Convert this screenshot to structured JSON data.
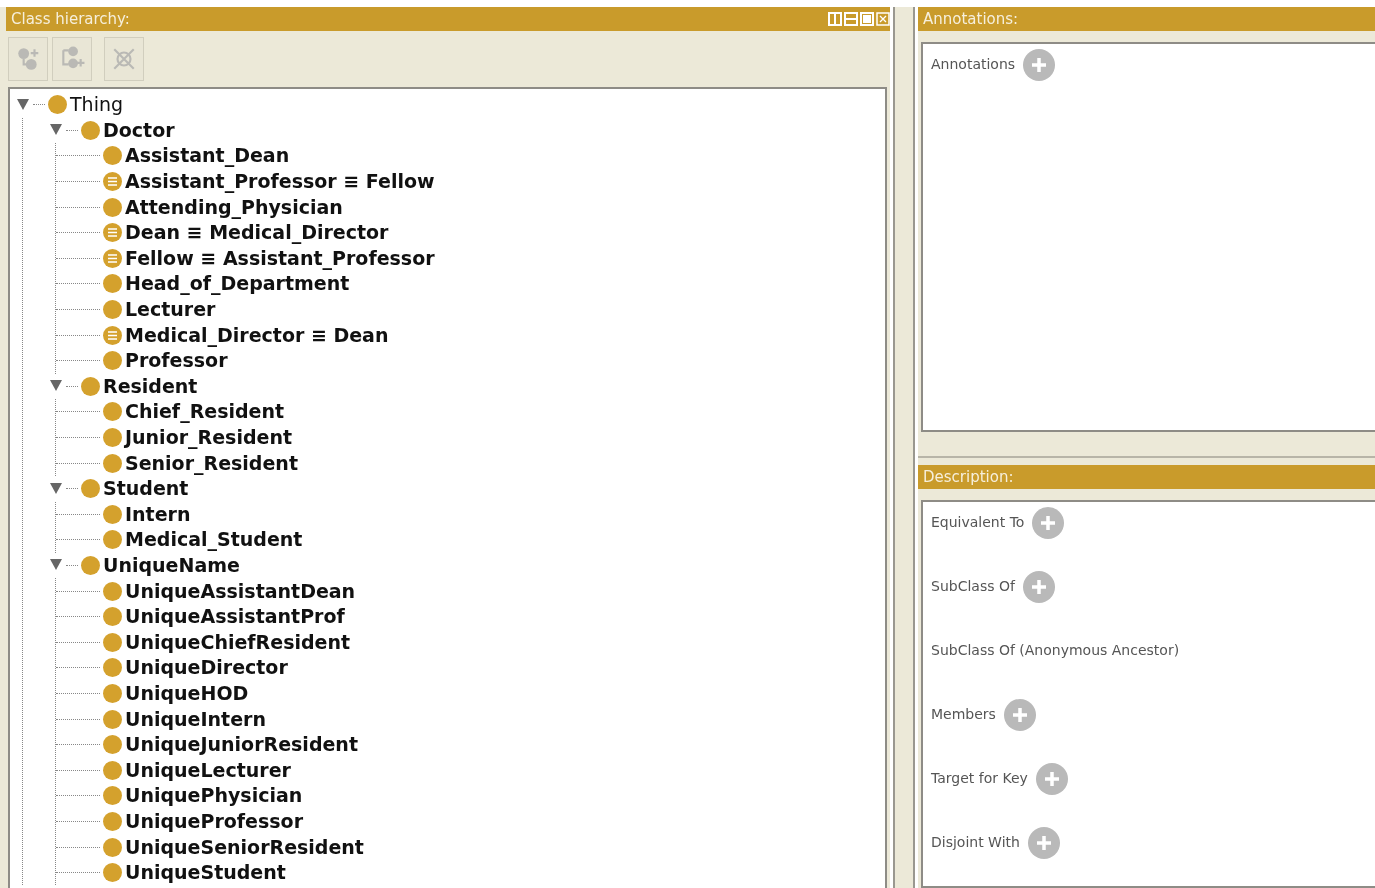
{
  "class_hierarchy": {
    "title": "Class hierarchy:",
    "toolbar": [
      {
        "kind": "add-subclass",
        "disabled": true
      },
      {
        "kind": "add-sibling",
        "disabled": true
      },
      {
        "kind": "delete",
        "disabled": true
      }
    ],
    "tree": [
      {
        "label": "Thing",
        "kind": "class",
        "expanded": true,
        "children": [
          {
            "label": "Doctor",
            "kind": "class",
            "expanded": true,
            "children": [
              {
                "label": "Assistant_Dean",
                "kind": "class"
              },
              {
                "label": "Assistant_Professor ≡ Fellow",
                "kind": "defined"
              },
              {
                "label": "Attending_Physician",
                "kind": "class"
              },
              {
                "label": "Dean ≡ Medical_Director",
                "kind": "defined"
              },
              {
                "label": "Fellow ≡ Assistant_Professor",
                "kind": "defined"
              },
              {
                "label": "Head_of_Department",
                "kind": "class"
              },
              {
                "label": "Lecturer",
                "kind": "class"
              },
              {
                "label": "Medical_Director ≡ Dean",
                "kind": "defined"
              },
              {
                "label": "Professor",
                "kind": "class"
              }
            ]
          },
          {
            "label": "Resident",
            "kind": "class",
            "expanded": true,
            "children": [
              {
                "label": "Chief_Resident",
                "kind": "class"
              },
              {
                "label": "Junior_Resident",
                "kind": "class"
              },
              {
                "label": "Senior_Resident",
                "kind": "class"
              }
            ]
          },
          {
            "label": "Student",
            "kind": "class",
            "expanded": true,
            "children": [
              {
                "label": "Intern",
                "kind": "class"
              },
              {
                "label": "Medical_Student",
                "kind": "class"
              }
            ]
          },
          {
            "label": "UniqueName",
            "kind": "class",
            "expanded": true,
            "children": [
              {
                "label": "UniqueAssistantDean",
                "kind": "class"
              },
              {
                "label": "UniqueAssistantProf",
                "kind": "class"
              },
              {
                "label": "UniqueChiefResident",
                "kind": "class"
              },
              {
                "label": "UniqueDirector",
                "kind": "class"
              },
              {
                "label": "UniqueHOD",
                "kind": "class"
              },
              {
                "label": "UniqueIntern",
                "kind": "class"
              },
              {
                "label": "UniqueJuniorResident",
                "kind": "class"
              },
              {
                "label": "UniqueLecturer",
                "kind": "class"
              },
              {
                "label": "UniquePhysician",
                "kind": "class"
              },
              {
                "label": "UniqueProfessor",
                "kind": "class"
              },
              {
                "label": "UniqueSeniorResident",
                "kind": "class"
              },
              {
                "label": "UniqueStudent",
                "kind": "class"
              }
            ]
          }
        ]
      }
    ]
  },
  "annotations": {
    "title": "Annotations:",
    "sections": [
      {
        "label": "Annotations",
        "has_add": true
      }
    ]
  },
  "description": {
    "title": "Description:",
    "sections": [
      {
        "label": "Equivalent To",
        "has_add": true
      },
      {
        "label": "SubClass Of",
        "has_add": true
      },
      {
        "label": "SubClass Of (Anonymous Ancestor)",
        "has_add": false
      },
      {
        "label": "Members",
        "has_add": true
      },
      {
        "label": "Target for Key",
        "has_add": true
      },
      {
        "label": "Disjoint With",
        "has_add": true
      }
    ]
  }
}
